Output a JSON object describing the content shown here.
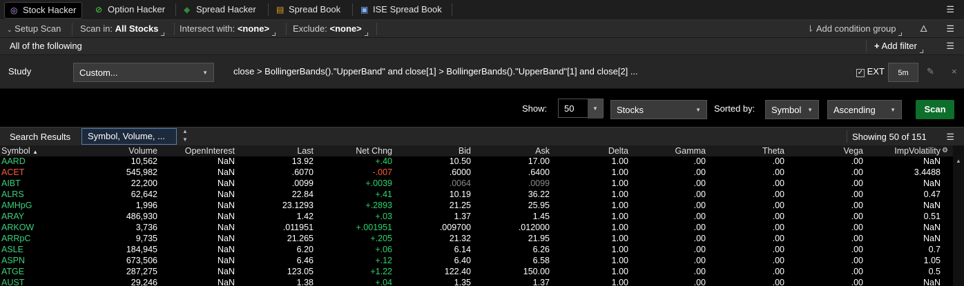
{
  "tabs": [
    {
      "label": "Stock Hacker",
      "icon": "stock-hacker-icon",
      "active": true
    },
    {
      "label": "Option Hacker",
      "icon": "option-hacker-icon"
    },
    {
      "label": "Spread Hacker",
      "icon": "spread-hacker-icon"
    },
    {
      "label": "Spread Book",
      "icon": "spread-book-icon"
    },
    {
      "label": "ISE Spread Book",
      "icon": "ise-spread-book-icon"
    }
  ],
  "setup": {
    "setup_scan": "Setup Scan",
    "scan_in_label": "Scan in:",
    "scan_in_value": "All Stocks",
    "intersect_label": "Intersect with:",
    "intersect_value": "<none>",
    "exclude_label": "Exclude:",
    "exclude_value": "<none>",
    "add_condition_group": "Add condition group"
  },
  "filter_group": {
    "label": "All of the following",
    "add_filter": "Add filter"
  },
  "study": {
    "label": "Study",
    "dropdown": "Custom...",
    "formula": "close > BollingerBands().\"UpperBand\" and close[1] > BollingerBands().\"UpperBand\"[1] and close[2] ...",
    "ext_label": "EXT",
    "ext_checked": true,
    "timeframe": "5m"
  },
  "options": {
    "show_label": "Show:",
    "show_value": "50",
    "type_value": "Stocks",
    "sorted_label": "Sorted by:",
    "sort_field": "Symbol",
    "sort_order": "Ascending",
    "scan_button": "Scan"
  },
  "results": {
    "tab_label": "Search Results",
    "columns_set": "Symbol, Volume, ...",
    "showing": "Showing 50 of 151"
  },
  "table": {
    "columns": [
      "Symbol",
      "Volume",
      "OpenInterest",
      "Last",
      "Net Chng",
      "Bid",
      "Ask",
      "Delta",
      "Gamma",
      "Theta",
      "Vega",
      "ImpVolatility"
    ],
    "rows": [
      [
        "AARD",
        "10,562",
        "NaN",
        "13.92",
        "+.40",
        "10.50",
        "17.00",
        "1.00",
        ".00",
        ".00",
        ".00",
        "NaN"
      ],
      [
        "ACET",
        "545,982",
        "NaN",
        ".6070",
        "-.007",
        ".6000",
        ".6400",
        "1.00",
        ".00",
        ".00",
        ".00",
        "3.4488"
      ],
      [
        "AIBT",
        "22,200",
        "NaN",
        ".0099",
        "+.0039",
        ".0064",
        ".0099",
        "1.00",
        ".00",
        ".00",
        ".00",
        "NaN"
      ],
      [
        "ALRS",
        "62,642",
        "NaN",
        "22.84",
        "+.41",
        "10.19",
        "36.22",
        "1.00",
        ".00",
        ".00",
        ".00",
        "0.47"
      ],
      [
        "AMHpG",
        "1,996",
        "NaN",
        "23.1293",
        "+.2893",
        "21.25",
        "25.95",
        "1.00",
        ".00",
        ".00",
        ".00",
        "NaN"
      ],
      [
        "ARAY",
        "486,930",
        "NaN",
        "1.42",
        "+.03",
        "1.37",
        "1.45",
        "1.00",
        ".00",
        ".00",
        ".00",
        "0.51"
      ],
      [
        "ARKOW",
        "3,736",
        "NaN",
        ".011951",
        "+.001951",
        ".009700",
        ".012000",
        "1.00",
        ".00",
        ".00",
        ".00",
        "NaN"
      ],
      [
        "ARRpC",
        "9,735",
        "NaN",
        "21.265",
        "+.205",
        "21.32",
        "21.95",
        "1.00",
        ".00",
        ".00",
        ".00",
        "NaN"
      ],
      [
        "ASLE",
        "184,945",
        "NaN",
        "6.20",
        "+.06",
        "6.14",
        "6.26",
        "1.00",
        ".00",
        ".00",
        ".00",
        "0.7"
      ],
      [
        "ASPN",
        "673,506",
        "NaN",
        "6.46",
        "+.12",
        "6.40",
        "6.58",
        "1.00",
        ".00",
        ".00",
        ".00",
        "1.05"
      ],
      [
        "ATGE",
        "287,275",
        "NaN",
        "123.05",
        "+1.22",
        "122.40",
        "150.00",
        "1.00",
        ".00",
        ".00",
        ".00",
        "0.5"
      ],
      [
        "AUST",
        "29,246",
        "NaN",
        "1.38",
        "+.04",
        "1.35",
        "1.37",
        "1.00",
        ".00",
        ".00",
        ".00",
        "NaN"
      ]
    ]
  },
  "colors": {
    "positive": "#2bd86a",
    "negative": "#ff5a3c",
    "symbol": "#3cd07b",
    "scan_button": "#0d6f2b"
  }
}
